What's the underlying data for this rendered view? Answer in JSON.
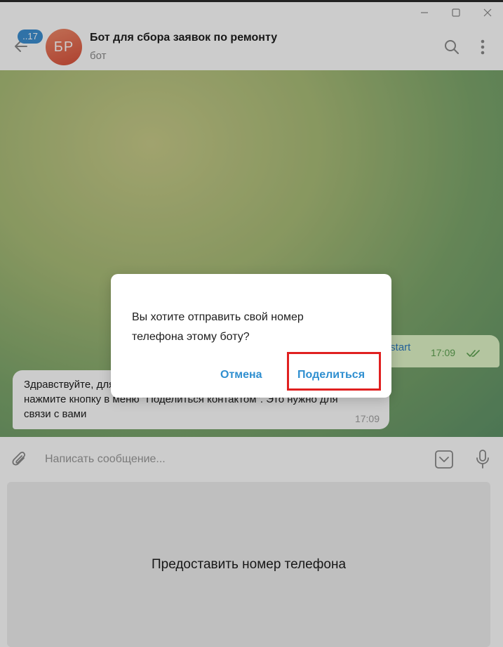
{
  "window": {
    "minimize_icon": "minimize-icon",
    "maximize_icon": "maximize-icon",
    "close_icon": "close-icon"
  },
  "header": {
    "unread_count": "..17",
    "avatar_initials": "БР",
    "title": "Бот для сбора заявок по ремонту",
    "subtitle": "бот"
  },
  "chat": {
    "outgoing": {
      "text": "/start",
      "time": "17:09"
    },
    "incoming": {
      "text": "Здравствуйте, для оформления заявки поделитесь, пожалуйста, нажмите кнопку в меню \"Поделиться контактом\". Это нужно для связи с вами",
      "time": "17:09"
    }
  },
  "composer": {
    "placeholder": "Написать сообщение..."
  },
  "keyboard": {
    "button_label": "Предоставить номер телефона"
  },
  "dialog": {
    "message": "Вы хотите отправить свой номер телефона этому боту?",
    "cancel_label": "Отмена",
    "share_label": "Поделиться"
  },
  "colors": {
    "accent": "#2f8fd0",
    "badge": "#3d8fd1",
    "highlight": "#e02020"
  }
}
